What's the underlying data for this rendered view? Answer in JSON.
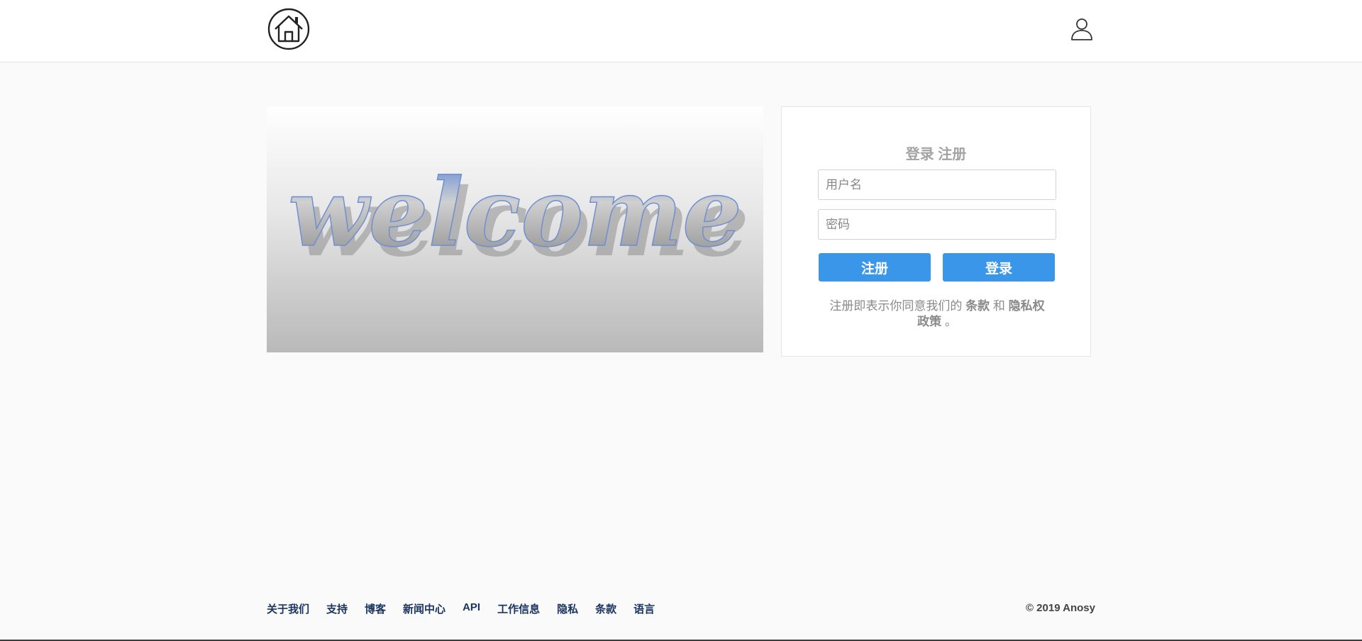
{
  "header": {
    "logo_icon": "home-icon",
    "user_icon": "user-icon"
  },
  "hero": {
    "image_text": "welcome"
  },
  "login_card": {
    "tab_login": "登录",
    "tab_register": "注册",
    "username_placeholder": "用户名",
    "password_placeholder": "密码",
    "register_button": "注册",
    "login_button": "登录",
    "terms_prefix": "注册即表示你同意我们的",
    "terms_link": "条款",
    "terms_and": "和",
    "privacy_link": "隐私权政策",
    "terms_suffix": "。"
  },
  "footer": {
    "links": [
      "关于我们",
      "支持",
      "博客",
      "新闻中心",
      "API",
      "工作信息",
      "隐私",
      "条款",
      "语言"
    ],
    "copyright": "© 2019 Anosy"
  },
  "colors": {
    "accent": "#3a96e8",
    "footer_link": "#1a3560",
    "page_bg": "#fafafa"
  }
}
